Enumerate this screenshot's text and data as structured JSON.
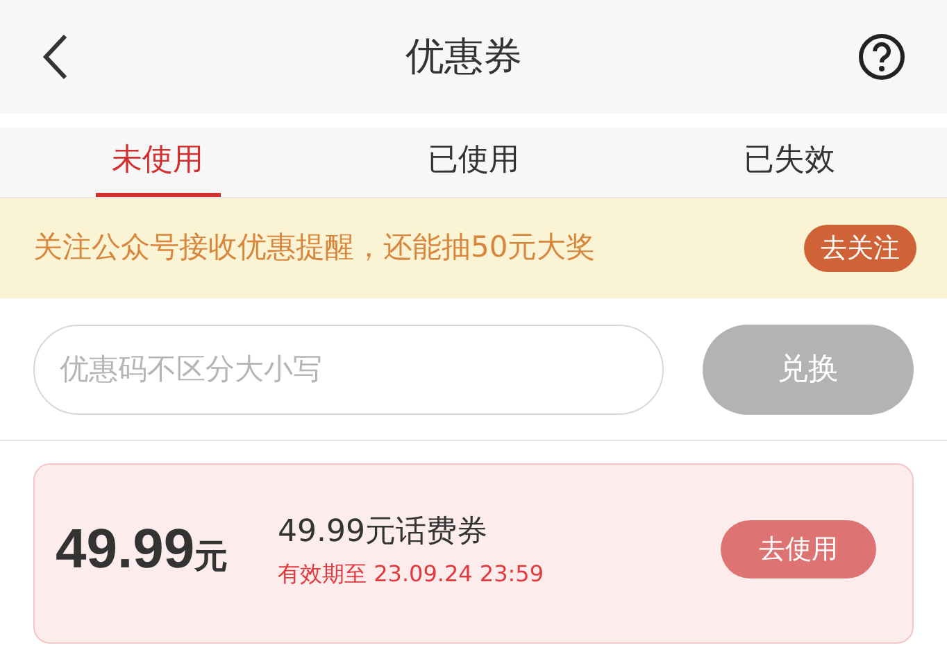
{
  "header": {
    "title": "优惠券"
  },
  "tabs": [
    {
      "label": "未使用",
      "selected": true
    },
    {
      "label": "已使用",
      "selected": false
    },
    {
      "label": "已失效",
      "selected": false
    }
  ],
  "banner": {
    "text": "关注公众号接收优惠提醒，还能抽50元大奖",
    "button": "去关注"
  },
  "redeem": {
    "placeholder": "优惠码不区分大小写",
    "button": "兑换",
    "disabled": true
  },
  "coupons": [
    {
      "amount": "49.99",
      "unit": "元",
      "name": "49.99元话费券",
      "validity": "有效期至 23.09.24 23:59",
      "button": "去使用"
    }
  ]
}
